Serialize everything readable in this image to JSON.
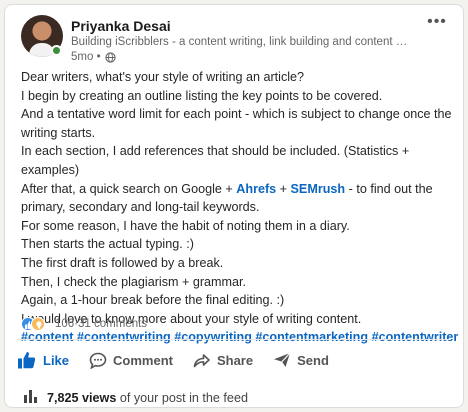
{
  "post": {
    "author": "Priyanka Desai",
    "headline": "Building iScribblers - a content writing, link building and content marketi...",
    "time": "5mo •",
    "more_label": "•••"
  },
  "body": {
    "line1": "Dear writers, what's your style of writing an article?",
    "line2": "I begin by creating an outline listing the key points to be covered.",
    "line3": "And a tentative word limit for each point - which is subject to change once the",
    "line4": "writing starts.",
    "line5": "In each section, I add references that should be included. (Statistics +",
    "line6": "examples)",
    "line7_pre": "After that, a quick search on Google + ",
    "line7_link1": "Ahrefs",
    "line7_mid": " + ",
    "line7_link2": "SEMrush",
    "line7_post": " - to find out the",
    "line8": "primary, secondary and long-tail keywords.",
    "line9": "For some reason, I have the habit of noting them in a diary.",
    "line10": "Then starts the actual typing. :)",
    "line11": "The first draft is followed by a break.",
    "line12": "Then, I check the plagiarism + grammar.",
    "line13": "Again, a 1-hour break before the final editing. :)",
    "line14": "I would love to know more about your style of writing content.",
    "hashtags": "#content #contentwriting #copywriting #contentmarketing #contentwriter"
  },
  "social": {
    "reactions_count": "106",
    "separator": " · ",
    "comments": "31 comments"
  },
  "actions": {
    "like": "Like",
    "comment": "Comment",
    "share": "Share",
    "send": "Send"
  },
  "views": {
    "count": "7,825 views",
    "suffix": " of your post in the feed"
  },
  "colors": {
    "accent": "#0a66c2",
    "like_reaction": "#378fe9",
    "insight_reaction": "#f5bb5c",
    "online": "#3d8b3d"
  },
  "icons": {
    "globe": "globe-icon",
    "like": "thumbs-up-icon",
    "comment": "comment-bubble-icon",
    "share": "share-arrow-icon",
    "send": "paper-plane-icon",
    "views": "bar-chart-icon"
  }
}
